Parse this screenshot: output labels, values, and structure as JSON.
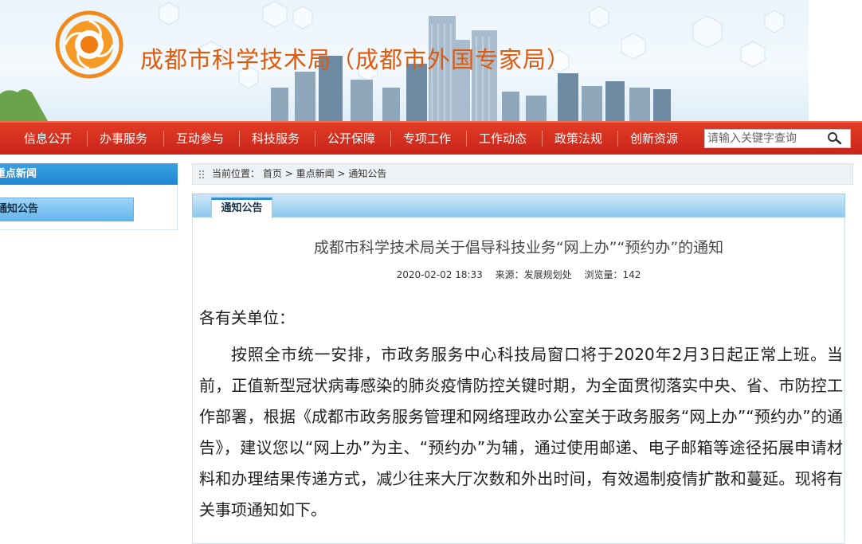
{
  "banner": {
    "title": "成都市科学技术局（成都市外国专家局）"
  },
  "nav": {
    "items": [
      "信息公开",
      "办事服务",
      "互动参与",
      "科技服务",
      "公开保障",
      "专项工作",
      "工作动态",
      "政策法规",
      "创新资源"
    ],
    "search_placeholder": "请输入关键字查询"
  },
  "sidebar": {
    "heading": "重点新闻",
    "item": "通知公告"
  },
  "breadcrumb": {
    "prefix": "当前位置：",
    "home": "首页",
    "sep": ">",
    "section": "重点新闻",
    "current": "通知公告"
  },
  "content": {
    "tab": "通知公告",
    "title": "成都市科学技术局关于倡导科技业务“网上办”“预约办”的通知",
    "date": "2020-02-02 18:33",
    "source": "来源：发展规划处",
    "views": "浏览量：142",
    "greeting": "各有关单位：",
    "body": "按照全市统一安排，市政务服务中心科技局窗口将于2020年2月3日起正常上班。当前，正值新型冠状病毒感染的肺炎疫情防控关键时期，为全面贯彻落实中央、省、市防控工作部署，根据《成都市政务服务管理和网络理政办公室关于政务服务“网上办”“预约办”的通告》，建议您以“网上办”为主、“预约办”为辅，通过使用邮递、电子邮箱等途径拓展申请材料和办理结果传递方式，减少往来大厅次数和外出时间，有效遏制疫情扩散和蔓延。现将有关事项通知如下。"
  },
  "colors": {
    "nav_red": "#d12f1f",
    "title_orange": "#e05a0c",
    "sidebar_blue": "#2a93d8"
  }
}
